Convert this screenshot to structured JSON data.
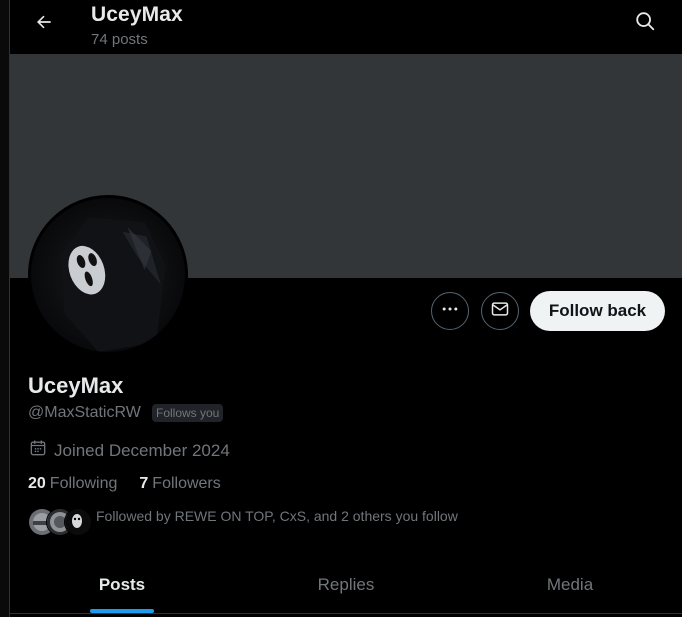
{
  "header": {
    "title": "UceyMax",
    "posts_count": "74 posts"
  },
  "profile": {
    "display_name": "UceyMax",
    "handle": "@MaxStaticRW",
    "follows_you_badge": "Follows you",
    "joined": "Joined December 2024",
    "following_count": "20",
    "following_label": "Following",
    "followers_count": "7",
    "followers_label": "Followers",
    "followed_by": "Followed by REWE ON TOP, CxS, and 2 others you follow"
  },
  "actions": {
    "follow_back_label": "Follow back"
  },
  "tabs": [
    {
      "label": "Posts",
      "active": true
    },
    {
      "label": "Replies",
      "active": false
    },
    {
      "label": "Media",
      "active": false
    }
  ],
  "colors": {
    "background": "#000000",
    "banner": "#333639",
    "accent": "#1d9bf0",
    "muted_text": "#71767b",
    "primary_text": "#e7e9ea"
  },
  "icons": [
    "back-arrow-icon",
    "search-icon",
    "more-icon",
    "message-icon",
    "calendar-icon"
  ]
}
